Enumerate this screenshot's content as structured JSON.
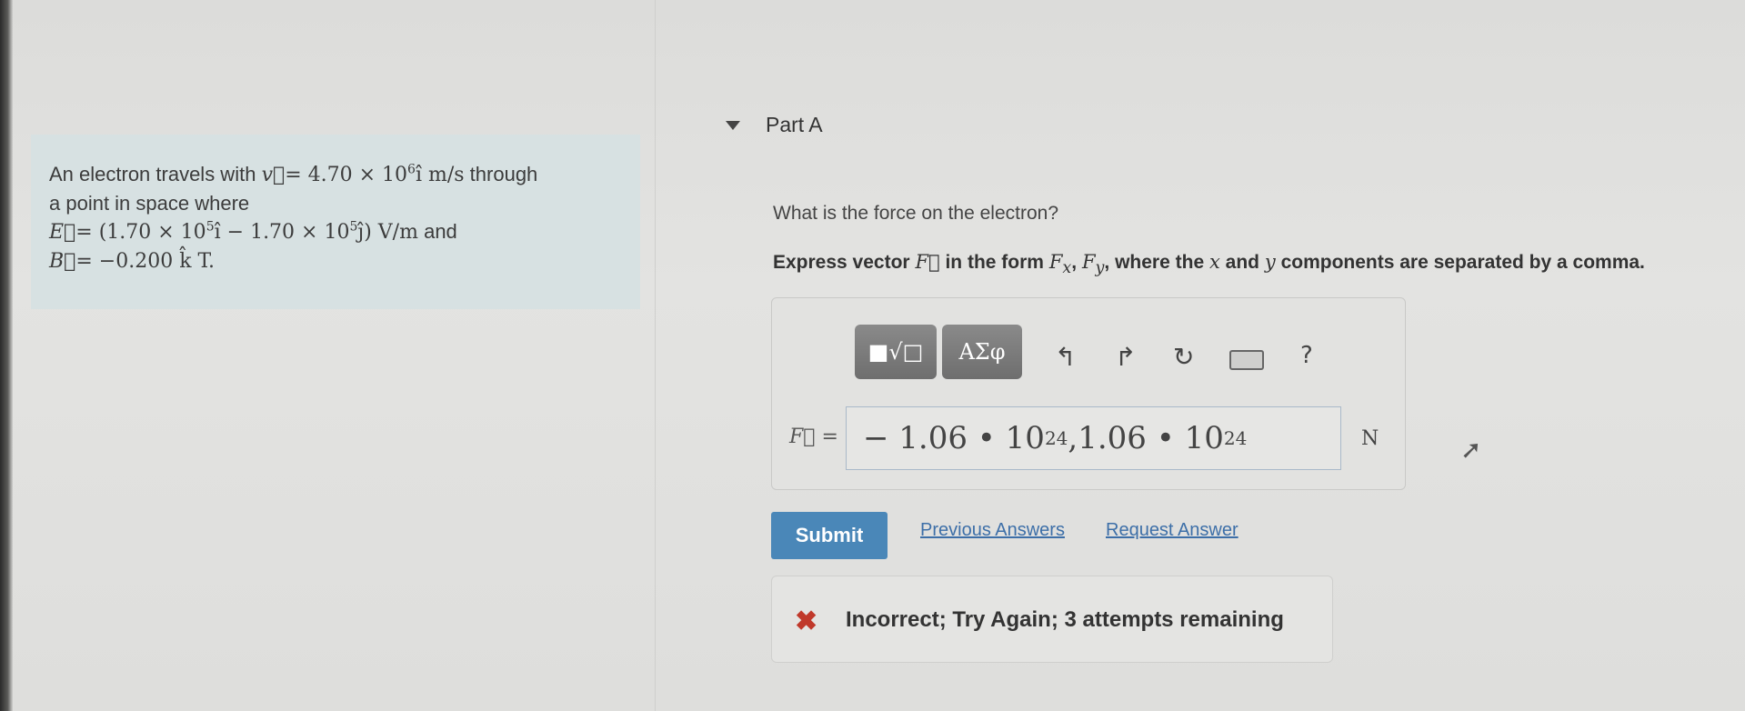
{
  "problem": {
    "line1_prefix": "An electron travels with",
    "v_symbol": "v⃗",
    "v_expr_pre": "= 4.70 × 10",
    "v_exp": "6",
    "v_expr_post": "î m/s",
    "line1_suffix": "through",
    "line2": "a point in space where",
    "E_symbol": "E⃗",
    "E_expr_a": "= (1.70 × 10",
    "E_exp1": "5",
    "E_expr_b": "î − 1.70 × 10",
    "E_exp2": "5",
    "E_expr_c": "ĵ) V/m",
    "and_word": "and",
    "B_symbol": "B⃗",
    "B_expr": "= −0.200 k̂ T."
  },
  "part": {
    "title": "Part A",
    "question": "What is the force on the electron?",
    "instruction_a": "Express vector",
    "instruction_F": "F⃗",
    "instruction_b": "in the form",
    "instruction_Fx": "F",
    "instruction_Fx_sub": "x",
    "instruction_comma": ",",
    "instruction_Fy": "F",
    "instruction_Fy_sub": "y",
    "instruction_c": ", where the",
    "instruction_x": "x",
    "instruction_d": "and",
    "instruction_y": "y",
    "instruction_e": "components are separated by a comma."
  },
  "toolbar": {
    "templates_label": "■√□",
    "greek_label": "ΑΣφ",
    "undo_icon": "undo-icon",
    "redo_icon": "redo-icon",
    "reset_icon": "reset-icon",
    "keyboard_icon": "keyboard-icon",
    "help_label": "?"
  },
  "answer": {
    "label": "F⃗ =",
    "part1": "− 1.06 • 10",
    "exp1": "24",
    "part2": ",1.06 • 10",
    "exp2": "24",
    "unit": "N"
  },
  "actions": {
    "submit_label": "Submit",
    "previous_answers": "Previous Answers",
    "request_answer": "Request Answer"
  },
  "feedback": {
    "icon": "x-icon",
    "text": "Incorrect; Try Again; 3 attempts remaining"
  },
  "colors": {
    "submit": "#4a87b8",
    "link": "#3d6fa8",
    "error": "#c0392b",
    "problem_bg": "#d7e1e2"
  }
}
